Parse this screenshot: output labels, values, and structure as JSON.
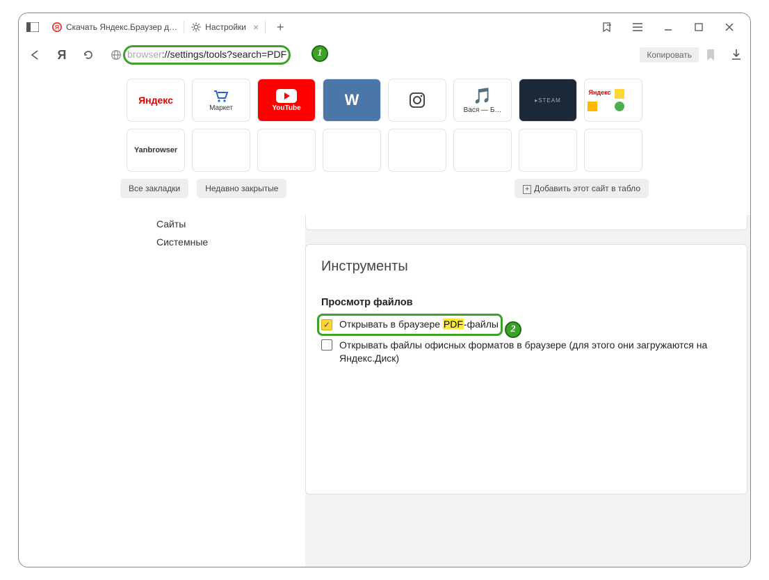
{
  "tabs": {
    "inactive_label": "Скачать Яндекс.Браузер д…",
    "active_label": "Настройки"
  },
  "addressbar": {
    "url_dim": "browser",
    "url_rest": "://settings/tools?search=PDF",
    "copy_label": "Копировать"
  },
  "speeddial": {
    "row1": [
      {
        "label": "Яндекс"
      },
      {
        "label": "Маркет"
      },
      {
        "label": "YouTube"
      },
      {
        "label": ""
      },
      {
        "label": ""
      },
      {
        "label": "Вася — Б…"
      },
      {
        "label": ""
      },
      {
        "label": "Яндекс"
      }
    ],
    "row2_first": "Yanbrowser"
  },
  "chips": {
    "all_bookmarks": "Все закладки",
    "recently_closed": "Недавно закрытые",
    "add_site": "Добавить этот сайт в табло"
  },
  "sidebar": {
    "item_sites": "Сайты",
    "item_system": "Системные"
  },
  "card": {
    "title": "Инструменты",
    "subtitle": "Просмотр файлов",
    "checkbox1_pre": "Открывать в браузере ",
    "checkbox1_hl": "PDF",
    "checkbox1_post": "-файлы",
    "checkbox2": "Открывать файлы офисных форматов в браузере (для этого они загружаются на Яндекс.Диск)"
  },
  "callouts": {
    "one": "1",
    "two": "2"
  }
}
